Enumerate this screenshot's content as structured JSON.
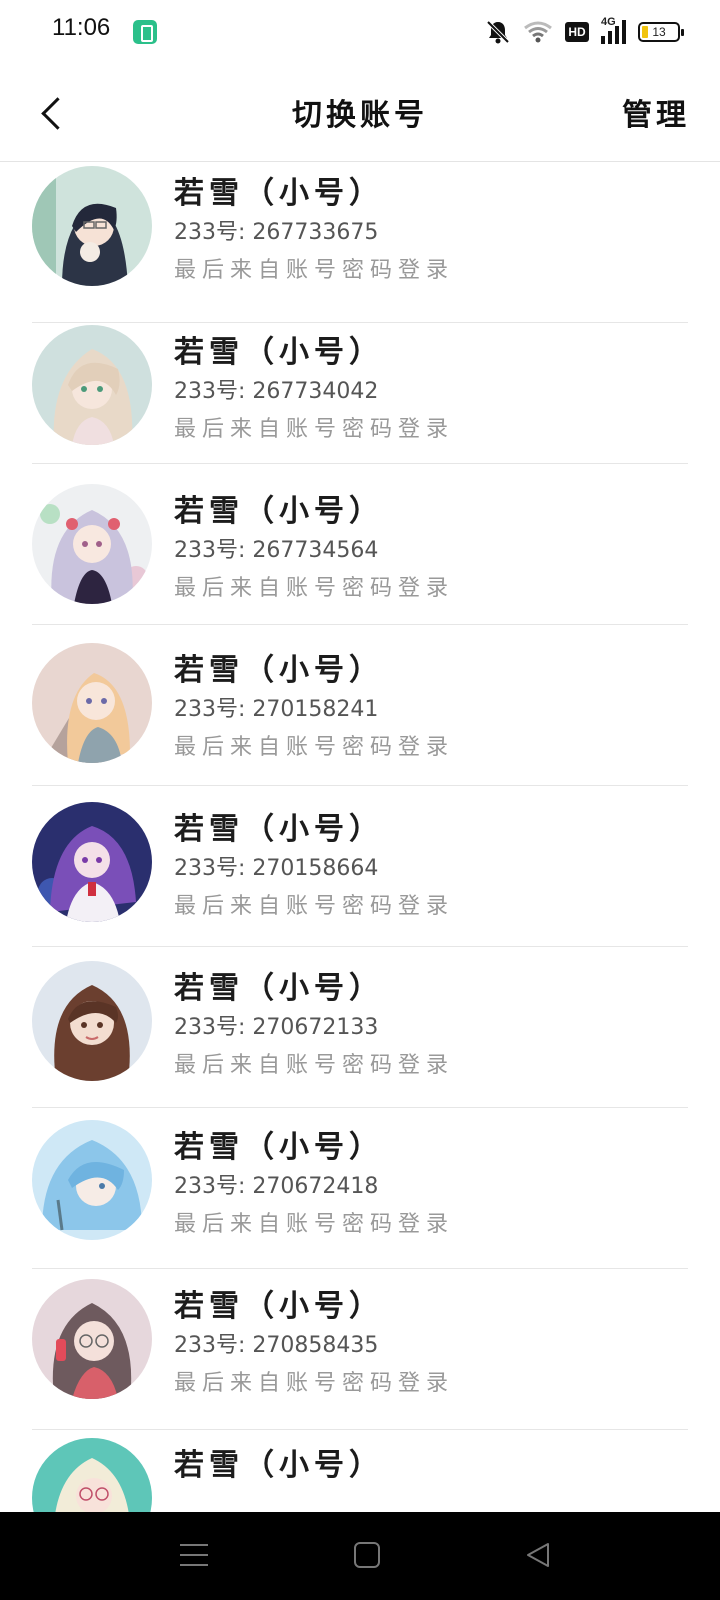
{
  "status_bar": {
    "time": "11:06",
    "battery_level": "13",
    "network": "4G",
    "hd": "HD"
  },
  "header": {
    "title": "切换账号",
    "manage": "管理"
  },
  "accounts": [
    {
      "name": "若雪（小号）",
      "id": "233号: 267733675",
      "note": "最后来自账号密码登录"
    },
    {
      "name": "若雪（小号）",
      "id": "233号: 267734042",
      "note": "最后来自账号密码登录"
    },
    {
      "name": "若雪（小号）",
      "id": "233号: 267734564",
      "note": "最后来自账号密码登录"
    },
    {
      "name": "若雪（小号）",
      "id": "233号: 270158241",
      "note": "最后来自账号密码登录"
    },
    {
      "name": "若雪（小号）",
      "id": "233号: 270158664",
      "note": "最后来自账号密码登录"
    },
    {
      "name": "若雪（小号）",
      "id": "233号: 270672133",
      "note": "最后来自账号密码登录"
    },
    {
      "name": "若雪（小号）",
      "id": "233号: 270672418",
      "note": "最后来自账号密码登录"
    },
    {
      "name": "若雪（小号）",
      "id": "233号: 270858435",
      "note": "最后来自账号密码登录"
    },
    {
      "name": "若雪（小号）",
      "id": "",
      "note": ""
    }
  ],
  "icons": {
    "back": "chevron-left-icon",
    "nav_menu": "menu-icon",
    "nav_home": "home-square-icon",
    "nav_back": "triangle-back-icon"
  },
  "colors": {
    "accent_battery_charging": "#2bc08a",
    "battery_low": "#f1c40f",
    "nav_background": "#000000"
  }
}
